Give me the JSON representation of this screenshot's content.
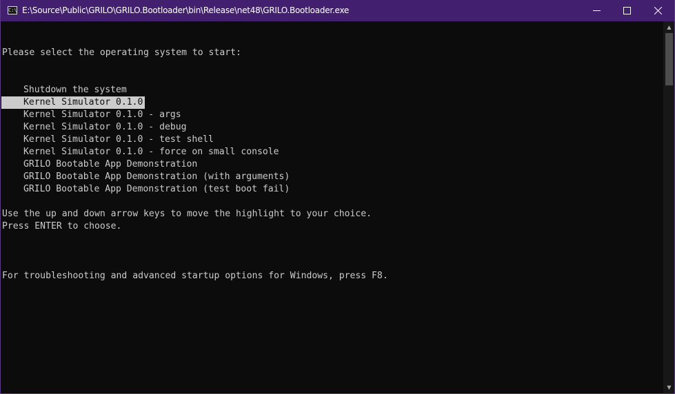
{
  "window": {
    "title": "E:\\Source\\Public\\GRILO\\GRILO.Bootloader\\bin\\Release\\net48\\GRILO.Bootloader.exe",
    "icon_text": "C:\\",
    "controls": [
      "minimize-icon",
      "maximize-icon",
      "close-icon"
    ]
  },
  "console": {
    "prompt": "Please select the operating system to start:",
    "menu_items": [
      "Shutdown the system",
      "Kernel Simulator 0.1.0",
      "Kernel Simulator 0.1.0 - args",
      "Kernel Simulator 0.1.0 - debug",
      "Kernel Simulator 0.1.0 - test shell",
      "Kernel Simulator 0.1.0 - force on small console",
      "GRILO Bootable App Demonstration",
      "GRILO Bootable App Demonstration (with arguments)",
      "GRILO Bootable App Demonstration (test boot fail)"
    ],
    "selected_index": 1,
    "instruction_1": "Use the up and down arrow keys to move the highlight to your choice.",
    "instruction_2": "Press ENTER to choose.",
    "troubleshoot": "For troubleshooting and advanced startup options for Windows, press F8."
  },
  "colors": {
    "titlebar": "#43206f",
    "console_bg": "#0c0c0c",
    "console_text": "#cccccc",
    "highlight_bg": "#cccccc"
  }
}
